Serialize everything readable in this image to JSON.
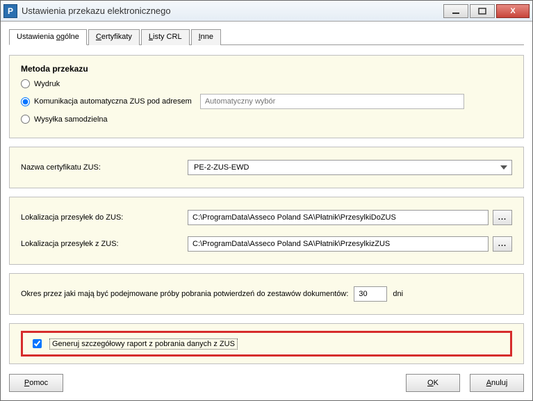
{
  "window": {
    "title": "Ustawienia przekazu elektronicznego"
  },
  "tabs": {
    "general": "Ustawienia ogólne",
    "general_key": "o",
    "certs": "Certyfikaty",
    "certs_key": "C",
    "crl": "Listy CRL",
    "crl_key": "L",
    "other": "Inne",
    "other_key": "I"
  },
  "method": {
    "title": "Metoda przekazu",
    "print": "Wydruk",
    "auto": "Komunikacja automatyczna ZUS pod adresem",
    "auto_placeholder": "Automatyczny wybór",
    "self": "Wysyłka samodzielna",
    "selected": "auto"
  },
  "cert": {
    "label": "Nazwa certyfikatu ZUS:",
    "value": "PE-2-ZUS-EWD"
  },
  "paths": {
    "to_label": "Lokalizacja przesyłek do ZUS:",
    "to_value": "C:\\ProgramData\\Asseco Poland SA\\Płatnik\\PrzesylkiDoZUS",
    "from_label": "Lokalizacja przesyłek z ZUS:",
    "from_value": "C:\\ProgramData\\Asseco Poland SA\\Płatnik\\PrzesylkizZUS",
    "browse": "..."
  },
  "period": {
    "label": "Okres przez jaki mają być podejmowane próby pobrania potwierdzeń do zestawów dokumentów:",
    "value": "30",
    "unit": "dni"
  },
  "report": {
    "label": "Generuj szczegółowy raport z pobrania danych z ZUS",
    "checked": true
  },
  "buttons": {
    "help": "Pomoc",
    "help_key": "P",
    "ok": "OK",
    "ok_key": "O",
    "cancel": "Anuluj",
    "cancel_key": "A"
  }
}
